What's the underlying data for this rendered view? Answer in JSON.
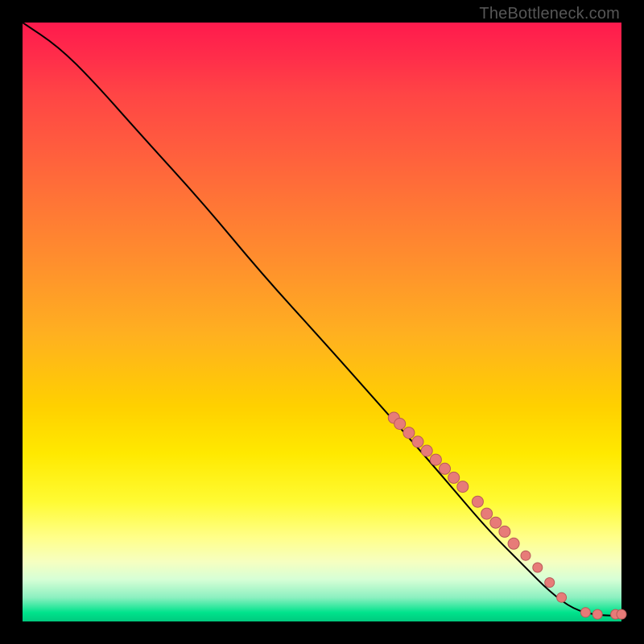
{
  "watermark": "TheBottleneck.com",
  "colors": {
    "dot_fill": "#e77b78",
    "dot_stroke": "#b85a58",
    "line": "#000000"
  },
  "chart_data": {
    "type": "line",
    "title": "",
    "xlabel": "",
    "ylabel": "",
    "xlim": [
      0,
      100
    ],
    "ylim": [
      0,
      100
    ],
    "grid": false,
    "line_points": [
      {
        "x": 0,
        "y": 100
      },
      {
        "x": 6,
        "y": 96
      },
      {
        "x": 12,
        "y": 90
      },
      {
        "x": 20,
        "y": 81
      },
      {
        "x": 30,
        "y": 70
      },
      {
        "x": 40,
        "y": 58
      },
      {
        "x": 50,
        "y": 47
      },
      {
        "x": 58,
        "y": 38
      },
      {
        "x": 66,
        "y": 29
      },
      {
        "x": 72,
        "y": 22
      },
      {
        "x": 78,
        "y": 15
      },
      {
        "x": 84,
        "y": 9
      },
      {
        "x": 88,
        "y": 5
      },
      {
        "x": 92,
        "y": 2
      },
      {
        "x": 96,
        "y": 1
      },
      {
        "x": 100,
        "y": 1
      }
    ],
    "data_points": [
      {
        "x": 62,
        "y": 34,
        "r": 7
      },
      {
        "x": 63,
        "y": 33,
        "r": 7
      },
      {
        "x": 64.5,
        "y": 31.5,
        "r": 7
      },
      {
        "x": 66,
        "y": 30,
        "r": 7
      },
      {
        "x": 67.5,
        "y": 28.5,
        "r": 7
      },
      {
        "x": 69,
        "y": 27,
        "r": 7
      },
      {
        "x": 70.5,
        "y": 25.5,
        "r": 7
      },
      {
        "x": 72,
        "y": 24,
        "r": 7
      },
      {
        "x": 73.5,
        "y": 22.5,
        "r": 7
      },
      {
        "x": 76,
        "y": 20,
        "r": 7
      },
      {
        "x": 77.5,
        "y": 18,
        "r": 7
      },
      {
        "x": 79,
        "y": 16.5,
        "r": 7
      },
      {
        "x": 80.5,
        "y": 15,
        "r": 7
      },
      {
        "x": 82,
        "y": 13,
        "r": 7
      },
      {
        "x": 84,
        "y": 11,
        "r": 6
      },
      {
        "x": 86,
        "y": 9,
        "r": 6
      },
      {
        "x": 88,
        "y": 6.5,
        "r": 6
      },
      {
        "x": 90,
        "y": 4,
        "r": 6
      },
      {
        "x": 94,
        "y": 1.5,
        "r": 6
      },
      {
        "x": 96,
        "y": 1.2,
        "r": 6
      },
      {
        "x": 99,
        "y": 1.2,
        "r": 6
      },
      {
        "x": 100,
        "y": 1.2,
        "r": 6
      }
    ]
  }
}
